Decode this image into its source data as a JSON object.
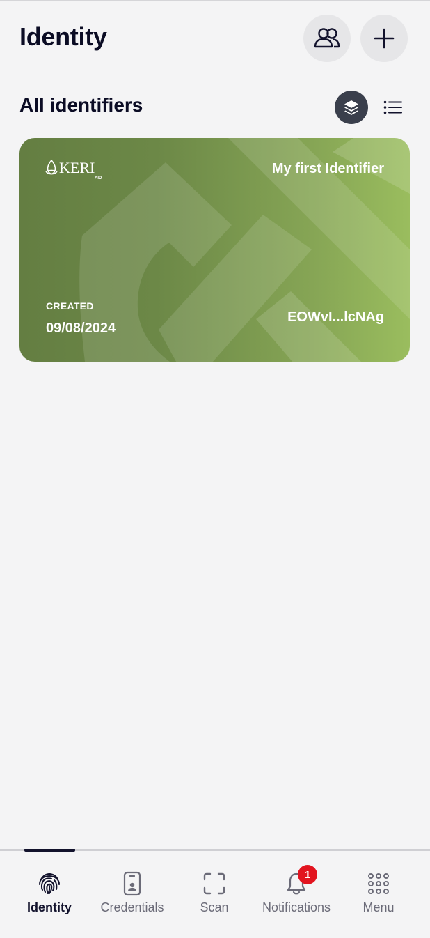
{
  "header": {
    "title": "Identity",
    "connections_icon": "people-icon",
    "add_icon": "plus-icon"
  },
  "section": {
    "title": "All identifiers",
    "stack_view_icon": "layers-icon",
    "list_view_icon": "list-icon"
  },
  "card": {
    "logo_text": "KERI",
    "logo_subtext": "AID",
    "name": "My first Identifier",
    "created_label": "CREATED",
    "created_date": "09/08/2024",
    "aid_short": "EOWvI...lcNAg",
    "colors": {
      "start": "#647e42",
      "end": "#9abd5e"
    }
  },
  "tabbar": {
    "items": [
      {
        "label": "Identity",
        "icon": "fingerprint-icon",
        "active": true
      },
      {
        "label": "Credentials",
        "icon": "id-card-icon",
        "active": false
      },
      {
        "label": "Scan",
        "icon": "scan-icon",
        "active": false
      },
      {
        "label": "Notifications",
        "icon": "bell-icon",
        "active": false,
        "badge": "1"
      },
      {
        "label": "Menu",
        "icon": "grid-icon",
        "active": false
      }
    ]
  },
  "colors": {
    "background": "#f4f4f5",
    "text_primary": "#0b0c24",
    "badge": "#e2141f"
  }
}
